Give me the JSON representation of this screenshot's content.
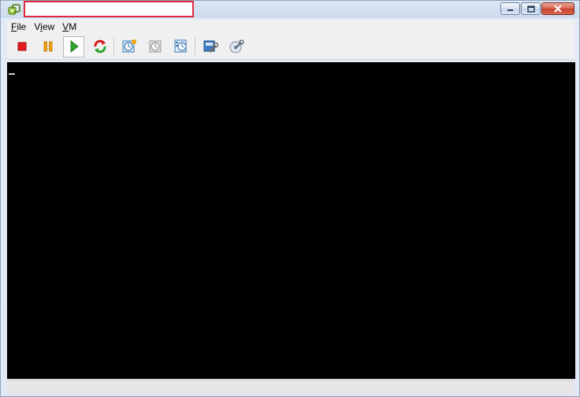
{
  "window": {
    "title": ""
  },
  "menu": {
    "file_accel": "F",
    "file_rest": "ile",
    "view_pre": "V",
    "view_accel": "i",
    "view_rest": "ew",
    "vm_accel": "V",
    "vm_rest": "M"
  },
  "toolbar": {
    "buttons": [
      {
        "icon": "stop-icon"
      },
      {
        "icon": "pause-icon"
      },
      {
        "icon": "play-icon",
        "pressed": true
      },
      {
        "icon": "reset-icon"
      },
      {
        "icon": "snapshot-icon"
      },
      {
        "icon": "revert-snapshot-icon"
      },
      {
        "icon": "snapshot-manager-icon"
      },
      {
        "icon": "settings-icon"
      },
      {
        "icon": "tools-icon"
      }
    ]
  },
  "console": {
    "background": "#000000",
    "cursor_color": "#c8c8c8"
  }
}
